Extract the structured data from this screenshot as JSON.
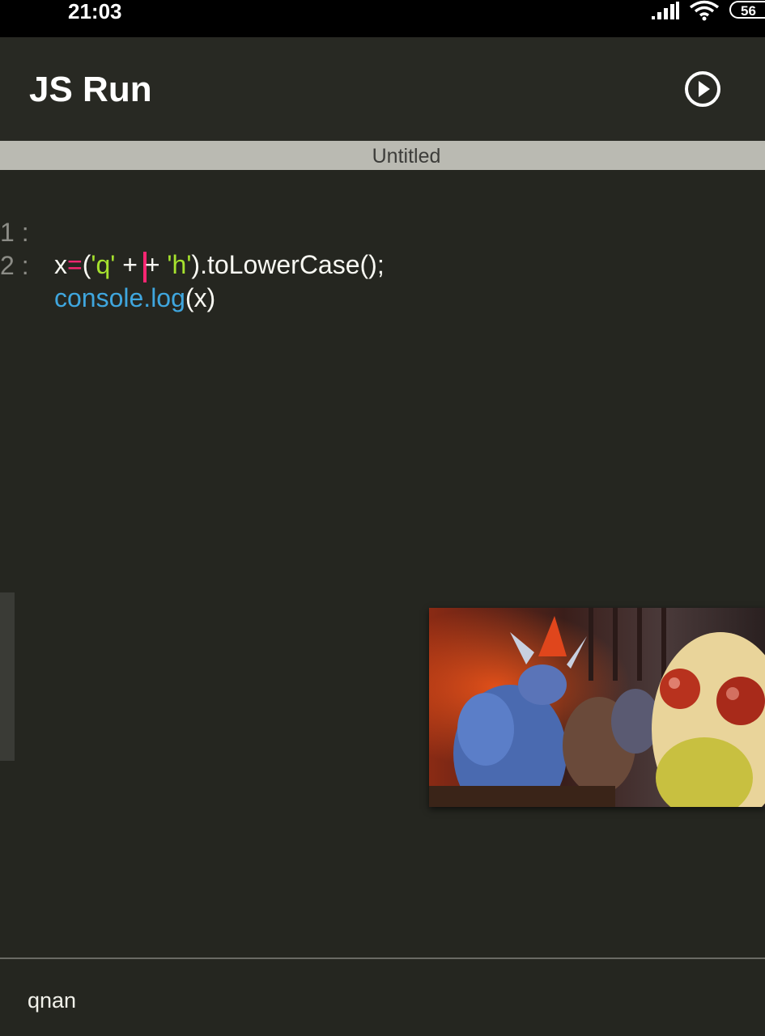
{
  "status_bar": {
    "time": "21:03",
    "battery_level": "56",
    "icons": [
      "signal-icon",
      "wifi-icon",
      "battery-icon"
    ]
  },
  "app_bar": {
    "title": "JS Run",
    "run_icon": "play-circle-icon"
  },
  "tabs": [
    {
      "label": "Untitled",
      "active": true
    }
  ],
  "editor": {
    "lines": [
      {
        "number": "1 :",
        "text": "x=('q' + + 'h').toLowerCase();"
      },
      {
        "number": "2 :",
        "text": "console.log(x)"
      }
    ],
    "cursor_line": 1
  },
  "console": {
    "output": "qnan"
  },
  "colors": {
    "background": "#252620",
    "keyword_red": "#f92672",
    "string_green": "#a6e22e",
    "function_blue": "#3fa6de",
    "tab_strip": "#babab2"
  },
  "overlay": {
    "type": "picture-in-picture video",
    "content": "game-scene-thumbnail"
  }
}
